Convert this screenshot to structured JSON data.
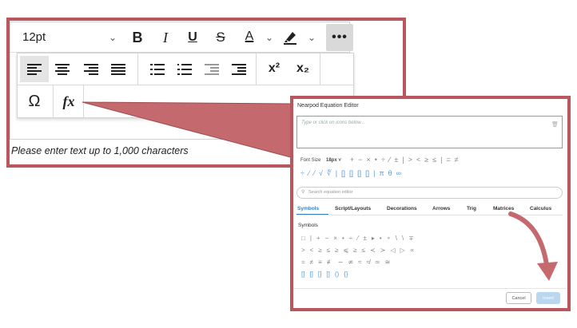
{
  "editor": {
    "font_size": "12pt",
    "bold": "B",
    "italic": "I",
    "underline": "U",
    "strikethrough": "S",
    "text_color": "A",
    "more": "•••",
    "superscript": "x²",
    "subscript": "x₂",
    "omega": "Ω",
    "fx": "fx",
    "hint": "Please enter text up to 1,000 characters"
  },
  "equation_editor": {
    "title": "Nearpod Equation Editor",
    "placeholder": "Type or click on icons below...",
    "font_size_label": "Font Size",
    "font_size_value": "18px",
    "row1_symbols": [
      "+",
      "−",
      "×",
      "•",
      "÷",
      "⁄",
      "±",
      "|",
      ">",
      "<",
      "≥",
      "≤",
      "|",
      "=",
      "≠"
    ],
    "row2_symbols": [
      "÷",
      "⁄",
      "⁄",
      "√",
      "∜",
      "|",
      "[]",
      "[]",
      "[]",
      "[]",
      "|",
      "π",
      "θ",
      "∞"
    ],
    "search_placeholder": "Search equation editor",
    "tabs": [
      "Symbols",
      "Script/Layouts",
      "Decorations",
      "Arrows",
      "Trig",
      "Matrices",
      "Calculus"
    ],
    "symbols_heading": "Symbols",
    "grid_rows": [
      [
        "□",
        "|",
        "+",
        "−",
        "×",
        "•",
        "÷",
        "⁄",
        "±",
        "▸",
        "•",
        "∘",
        "\\",
        "\\",
        "∓"
      ],
      [
        ">",
        "<",
        "≥",
        "≤",
        "≥",
        "⩽",
        "≥",
        "≤",
        "≺",
        "≻",
        "◁",
        "▷",
        "∝"
      ],
      [
        "=",
        "≠",
        "≡",
        "≢",
        "∼",
        "≄",
        "≈",
        "≉",
        "≃",
        "≅"
      ],
      [
        "[]",
        "[]",
        "[]",
        "[]",
        "()",
        "{}"
      ]
    ],
    "cancel": "Cancel",
    "insert": "Insert"
  },
  "colors": {
    "accent_frame": "#b9575d",
    "tab_active": "#3a7fc4",
    "insert_button": "#b9d7ef"
  }
}
